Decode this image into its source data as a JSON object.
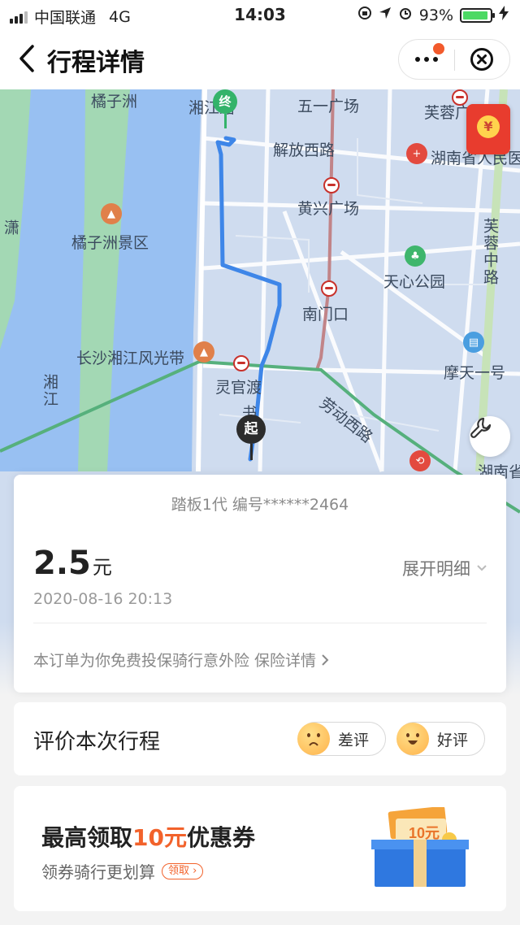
{
  "status_bar": {
    "carrier": "中国联通",
    "network": "4G",
    "time": "14:03",
    "battery_percent": "93%",
    "battery_level": 0.93,
    "icons": [
      "lock-rotation-icon",
      "location-arrow-icon",
      "alarm-icon",
      "charging-bolt-icon"
    ]
  },
  "nav": {
    "title": "行程详情",
    "back_icon": "chevron-left-icon",
    "more_icon": "more-dots-icon",
    "close_icon": "close-circle-icon"
  },
  "map": {
    "labels": {
      "juzizhou": "橘子洲",
      "xiangjiang_road": "湘江路",
      "wuyi_square": "五一广场",
      "furong_top": "芙蓉广",
      "jiefang_west": "解放西路",
      "hunan_hospital": "湖南省人民医",
      "huangxing_square": "黄兴广场",
      "juzizhou_scenic": "橘子洲景区",
      "tianxin_park": "天心公园",
      "furong_middle": "芙蓉中路",
      "nanmenkou": "南门口",
      "scenic_belt": "长沙湘江风光带",
      "motianyi": "摩天一号",
      "lingguandu": "灵官渡",
      "laodong_west": "劳动西路",
      "xiangjiang": "湘江",
      "xiao_left": "潇",
      "hunan_sheng": "湖南省",
      "start_road": "书路"
    },
    "markers": {
      "end": "终",
      "start": "起"
    },
    "colors": {
      "water": "#98c0f2",
      "route": "#3e86e8",
      "land": "#cfdcef",
      "green": "#a3d8b4"
    }
  },
  "order": {
    "vehicle_info": "踏板1代 编号******2464",
    "price": "2.5",
    "price_unit": "元",
    "expand_label": "展开明细",
    "datetime": "2020-08-16 20:13",
    "insurance_text": "本订单为你免费投保骑行意外险 保险详情"
  },
  "rating": {
    "title": "评价本次行程",
    "bad_label": "差评",
    "good_label": "好评"
  },
  "coupon": {
    "title_prefix": "最高领取",
    "title_highlight": "10元",
    "title_suffix": "优惠券",
    "subtitle": "领券骑行更划算",
    "claim_label": "领取",
    "ticket_text": "10元",
    "accent_color": "#f2622b"
  }
}
